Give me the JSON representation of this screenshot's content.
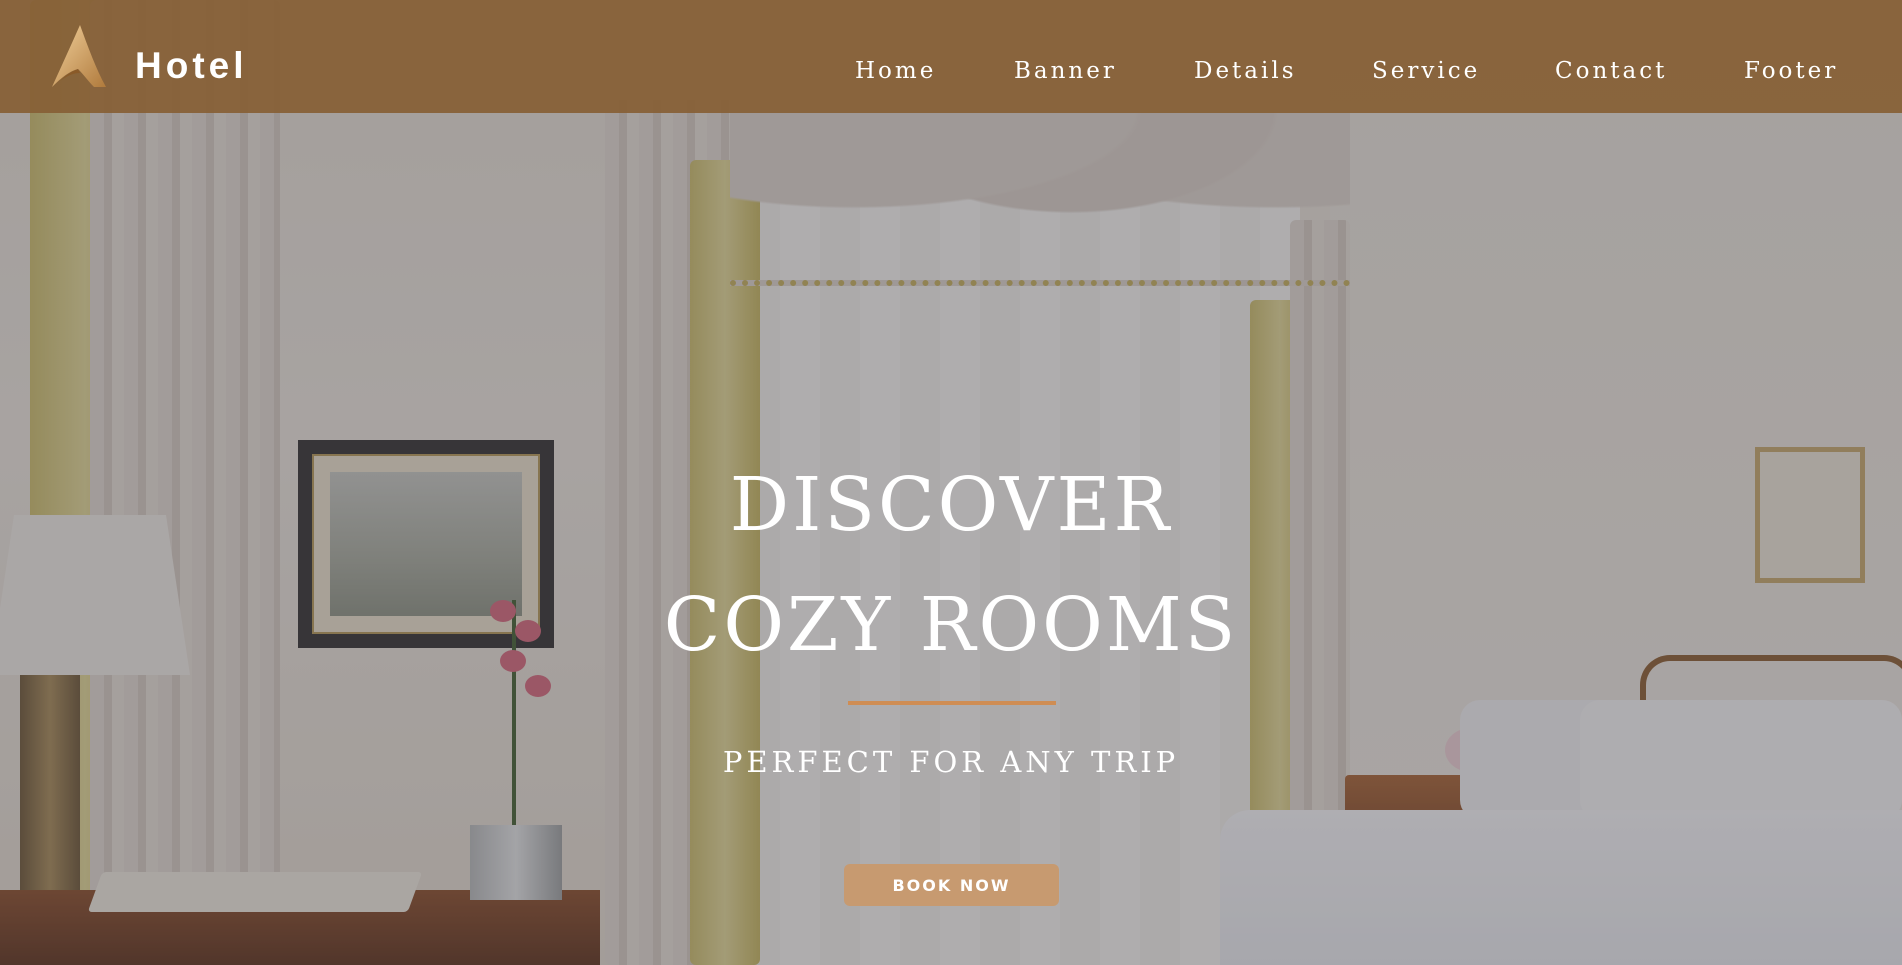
{
  "brand": {
    "name": "Hotel",
    "logo_icon": "hotel-logo-icon"
  },
  "nav": {
    "items": [
      {
        "label": "Home"
      },
      {
        "label": "Banner"
      },
      {
        "label": "Details"
      },
      {
        "label": "Service"
      },
      {
        "label": "Contact"
      },
      {
        "label": "Footer"
      }
    ]
  },
  "hero": {
    "headline_line1": "DISCOVER",
    "headline_line2": "COZY ROOMS",
    "tagline": "PERFECT FOR ANY TRIP",
    "cta_label": "BOOK NOW",
    "background_image": "hotel-room-interior-image"
  },
  "colors": {
    "navbar": "#86603a",
    "accent_divider": "#cf8d54",
    "cta_button": "#c79a70",
    "text": "#ffffff"
  }
}
